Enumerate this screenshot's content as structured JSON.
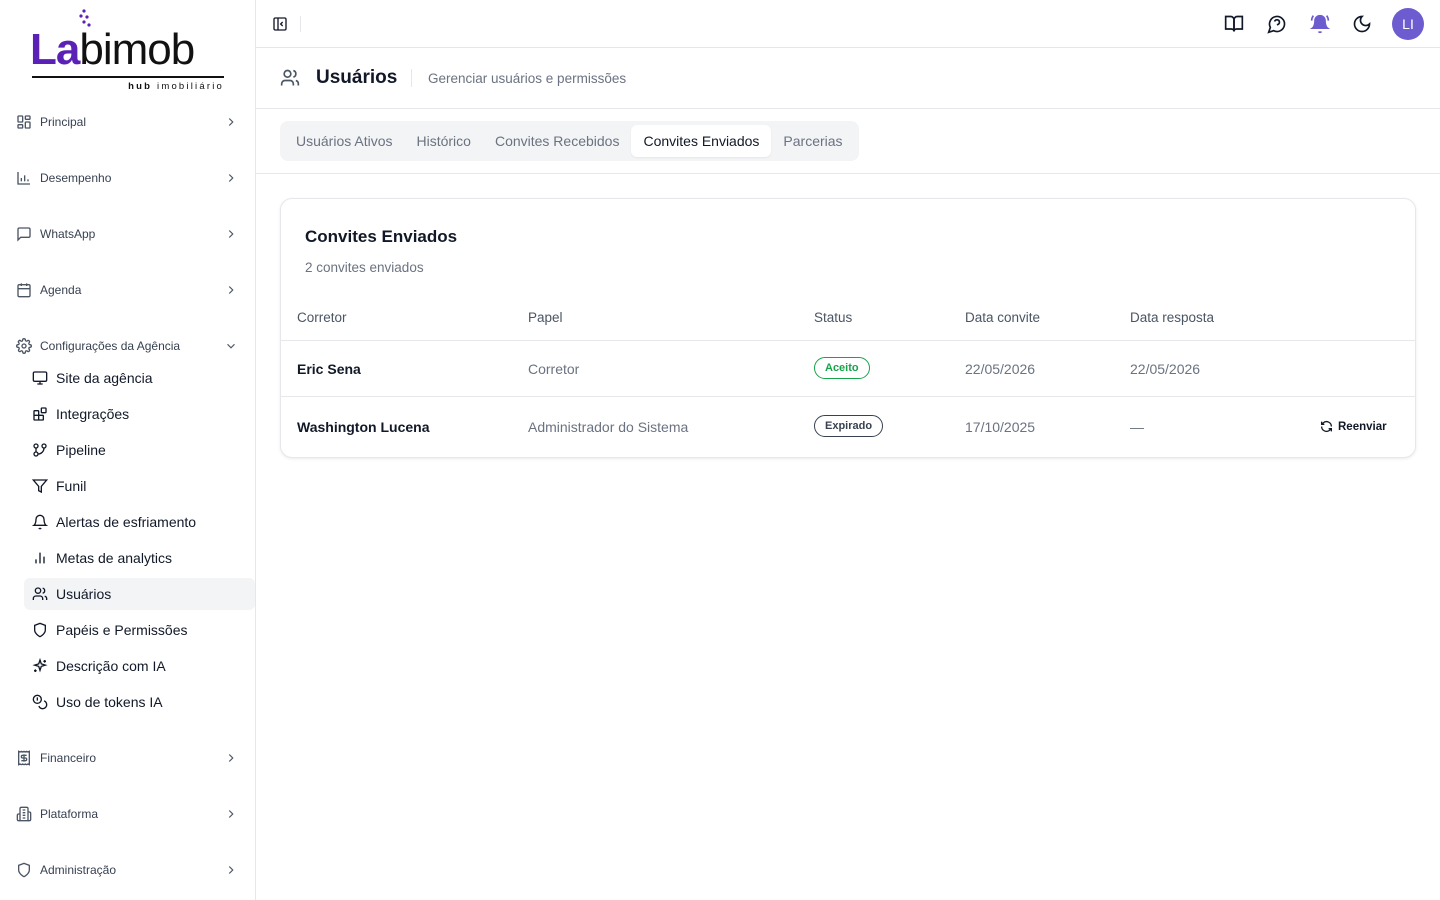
{
  "brand": {
    "logo_prefix": "La",
    "logo_suffix": "imob",
    "logo_b": "b",
    "logo_sub_bold": "hub",
    "logo_sub_rest": " imobiliário",
    "accent": "#5b21b6"
  },
  "sidebar": {
    "groups": [
      {
        "label": "Principal",
        "icon": "layout-grid-icon"
      },
      {
        "label": "Desempenho",
        "icon": "bar-chart-icon"
      },
      {
        "label": "WhatsApp",
        "icon": "message-square-icon"
      },
      {
        "label": "Agenda",
        "icon": "calendar-icon"
      },
      {
        "label": "Configurações da Agência",
        "icon": "settings-icon"
      },
      {
        "label": "Financeiro",
        "icon": "receipt-icon"
      },
      {
        "label": "Plataforma",
        "icon": "building-icon"
      },
      {
        "label": "Administração",
        "icon": "shield-icon"
      }
    ],
    "sub_items": [
      {
        "label": "Site da agência",
        "icon": "monitor-icon"
      },
      {
        "label": "Integrações",
        "icon": "blocks-icon"
      },
      {
        "label": "Pipeline",
        "icon": "git-branch-icon"
      },
      {
        "label": "Funil",
        "icon": "filter-icon"
      },
      {
        "label": "Alertas de esfriamento",
        "icon": "bell-icon"
      },
      {
        "label": "Metas de analytics",
        "icon": "chart-column-icon"
      },
      {
        "label": "Usuários",
        "icon": "users-icon",
        "active": true
      },
      {
        "label": "Papéis e Permissões",
        "icon": "shield-icon"
      },
      {
        "label": "Descrição com IA",
        "icon": "sparkles-icon"
      },
      {
        "label": "Uso de tokens IA",
        "icon": "coins-icon"
      }
    ]
  },
  "topbar": {
    "avatar_initials": "LI",
    "avatar_color": "#6d5bd0",
    "notification_color": "#6d5bd0",
    "icons": [
      "book-open-icon",
      "help-chat-icon",
      "notification-bell-icon",
      "moon-icon"
    ]
  },
  "page": {
    "title": "Usuários",
    "subtitle": "Gerenciar usuários e permissões"
  },
  "tabs": [
    "Usuários Ativos",
    "Histórico",
    "Convites Recebidos",
    "Convites Enviados",
    "Parcerias"
  ],
  "active_tab": "Convites Enviados",
  "card": {
    "title": "Convites Enviados",
    "description": "2 convites enviados",
    "columns": [
      "Corretor",
      "Papel",
      "Status",
      "Data convite",
      "Data resposta"
    ],
    "rows": [
      {
        "corretor": "Eric Sena",
        "papel": "Corretor",
        "status": "Aceito",
        "data_convite": "22/05/2026",
        "data_resposta": "22/05/2026",
        "action": ""
      },
      {
        "corretor": "Washington Lucena",
        "papel": "Administrador do Sistema",
        "status": "Expirado",
        "data_convite": "17/10/2025",
        "data_resposta": "—",
        "action": "Reenviar"
      }
    ],
    "status_colors": {
      "Aceito": "#16a34a",
      "Expirado": "#374151"
    }
  }
}
